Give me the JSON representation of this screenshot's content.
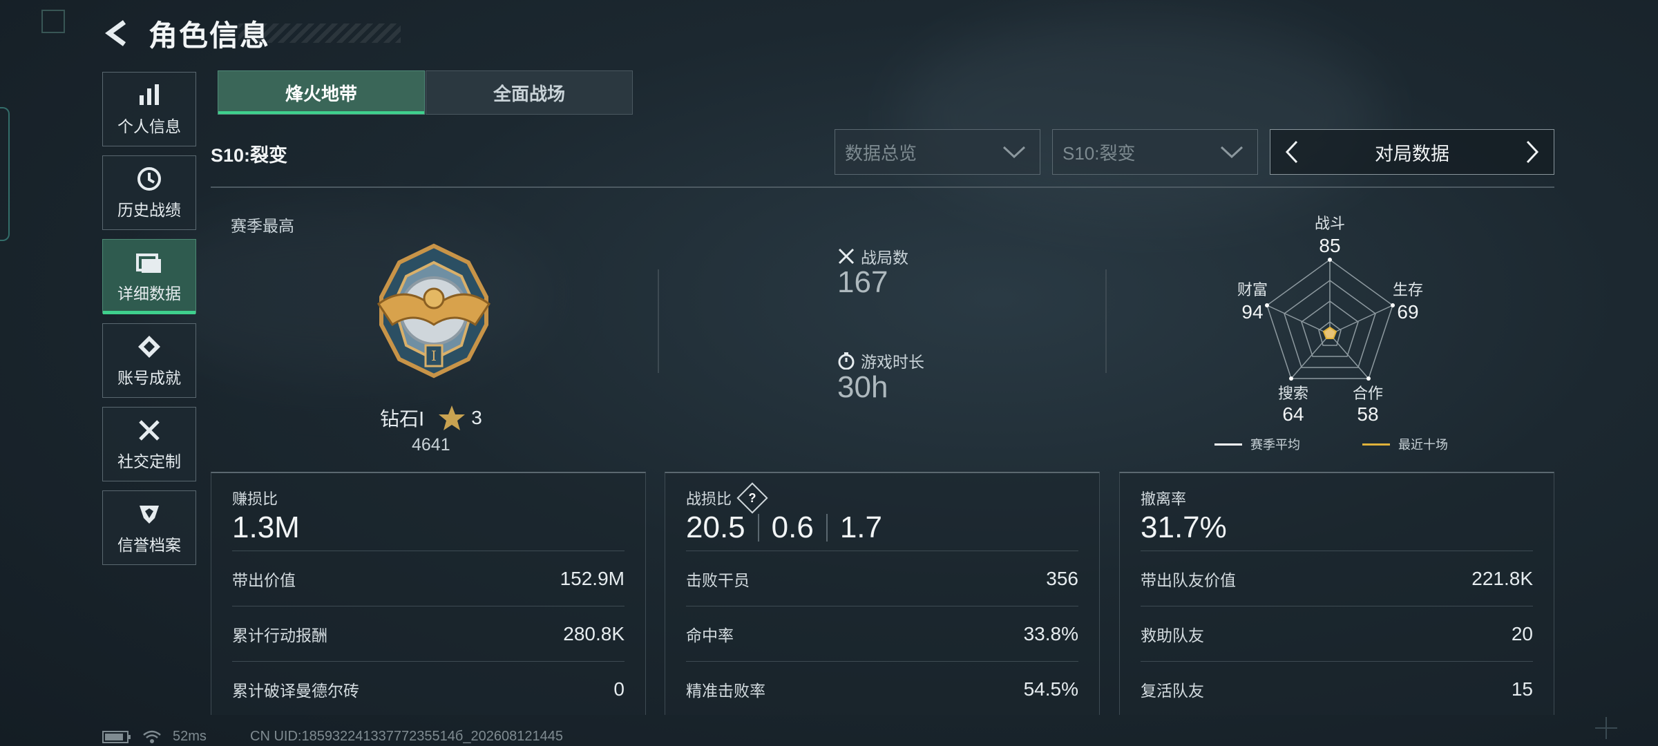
{
  "header": {
    "title": "角色信息"
  },
  "sidebar": {
    "items": [
      {
        "label": "个人信息",
        "icon": "bar-chart-icon"
      },
      {
        "label": "历史战绩",
        "icon": "history-icon"
      },
      {
        "label": "详细数据",
        "icon": "folder-icon",
        "active": true
      },
      {
        "label": "账号成就",
        "icon": "achievement-icon"
      },
      {
        "label": "社交定制",
        "icon": "tools-icon"
      },
      {
        "label": "信誉档案",
        "icon": "credit-shield-icon"
      }
    ]
  },
  "mode_tabs": [
    {
      "label": "烽火地带",
      "active": true
    },
    {
      "label": "全面战场",
      "active": false
    }
  ],
  "season_label": "S10:裂变",
  "filters": {
    "data_type": "数据总览",
    "season": "S10:裂变",
    "pager_label": "对局数据"
  },
  "overview": {
    "peak_label": "赛季最高",
    "rank_name": "钻石Ⅰ",
    "rank_stars": "3",
    "rank_score": "4641",
    "matches_label": "战局数",
    "matches_value": "167",
    "playtime_label": "游戏时长",
    "playtime_value": "30h"
  },
  "radar": {
    "axes": [
      {
        "label": "战斗",
        "value": "85"
      },
      {
        "label": "生存",
        "value": "69"
      },
      {
        "label": "合作",
        "value": "58"
      },
      {
        "label": "搜索",
        "value": "64"
      },
      {
        "label": "财富",
        "value": "94"
      }
    ],
    "legend": [
      {
        "label": "赛季平均",
        "color": "#ffffff"
      },
      {
        "label": "最近十场",
        "color": "#e0b23a"
      }
    ]
  },
  "cards": [
    {
      "title": "赚损比",
      "big": [
        "1.3M"
      ],
      "rows": [
        {
          "k": "带出价值",
          "v": "152.9M"
        },
        {
          "k": "累计行动报酬",
          "v": "280.8K"
        },
        {
          "k": "累计破译曼德尔砖",
          "v": "0"
        }
      ]
    },
    {
      "title": "战损比",
      "help": "?",
      "big": [
        "20.5",
        "0.6",
        "1.7"
      ],
      "rows": [
        {
          "k": "击败干员",
          "v": "356"
        },
        {
          "k": "命中率",
          "v": "33.8%"
        },
        {
          "k": "精准击败率",
          "v": "54.5%"
        }
      ]
    },
    {
      "title": "撤离率",
      "big": [
        "31.7%"
      ],
      "rows": [
        {
          "k": "带出队友价值",
          "v": "221.8K"
        },
        {
          "k": "救助队友",
          "v": "20"
        },
        {
          "k": "复活队友",
          "v": "15"
        }
      ]
    }
  ],
  "footer": {
    "ping": "52ms",
    "uid": "CN UID:18593224133777235514б_202608121445"
  }
}
